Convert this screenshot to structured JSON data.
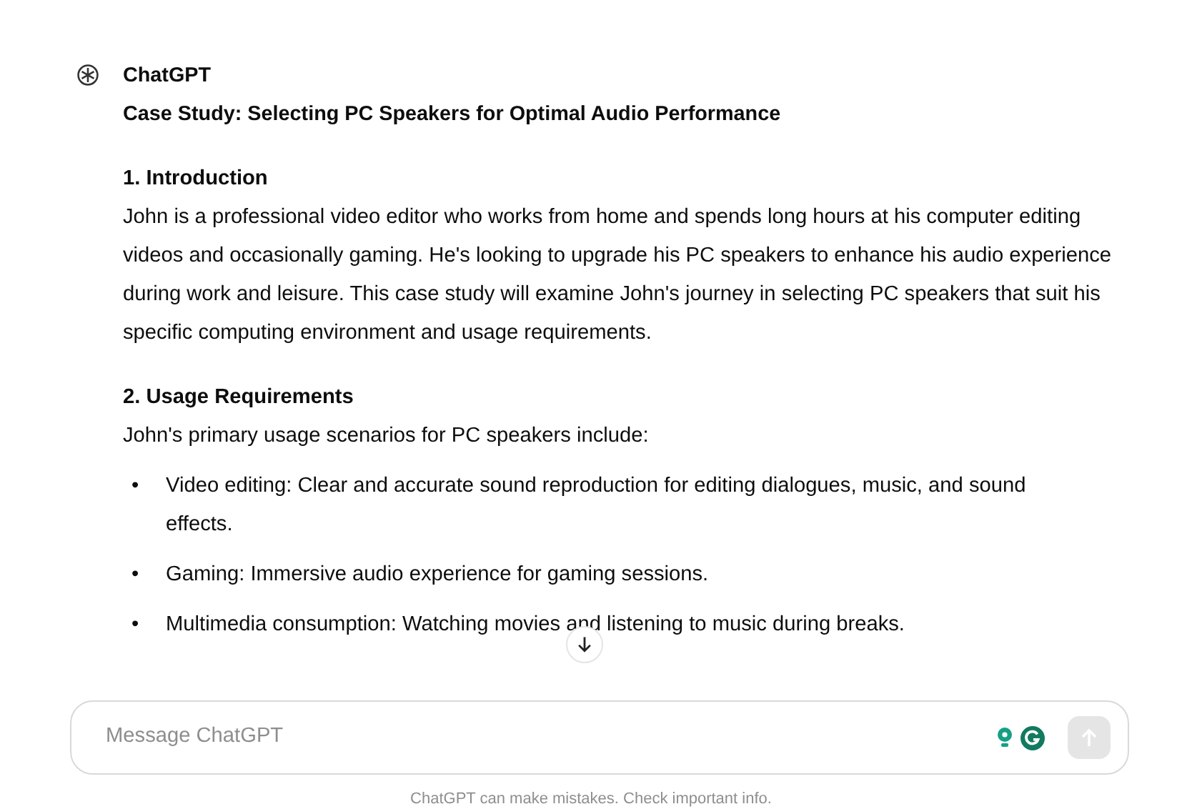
{
  "message": {
    "author": "ChatGPT",
    "title": "Case Study: Selecting PC Speakers for Optimal Audio Performance",
    "sections": [
      {
        "heading": "1. Introduction",
        "paragraph": "John is a professional video editor who works from home and spends long hours at his computer editing videos and occasionally gaming. He's looking to upgrade his PC speakers to enhance his audio experience during work and leisure. This case study will examine John's journey in selecting PC speakers that suit his specific computing environment and usage requirements."
      },
      {
        "heading": "2. Usage Requirements",
        "paragraph": "John's primary usage scenarios for PC speakers include:",
        "bullets": [
          {
            "marker": "•",
            "text": "Video editing: Clear and accurate sound reproduction for editing dialogues, music, and sound effects."
          },
          {
            "marker": "•",
            "text": "Gaming: Immersive audio experience for gaming sessions."
          },
          {
            "marker": "•",
            "text": "Multimedia consumption: Watching movies and listening to music during breaks."
          }
        ]
      }
    ]
  },
  "composer": {
    "placeholder": "Message ChatGPT",
    "send_button": {
      "disabled": true
    }
  },
  "footer": "ChatGPT can make mistakes. Check important info."
}
